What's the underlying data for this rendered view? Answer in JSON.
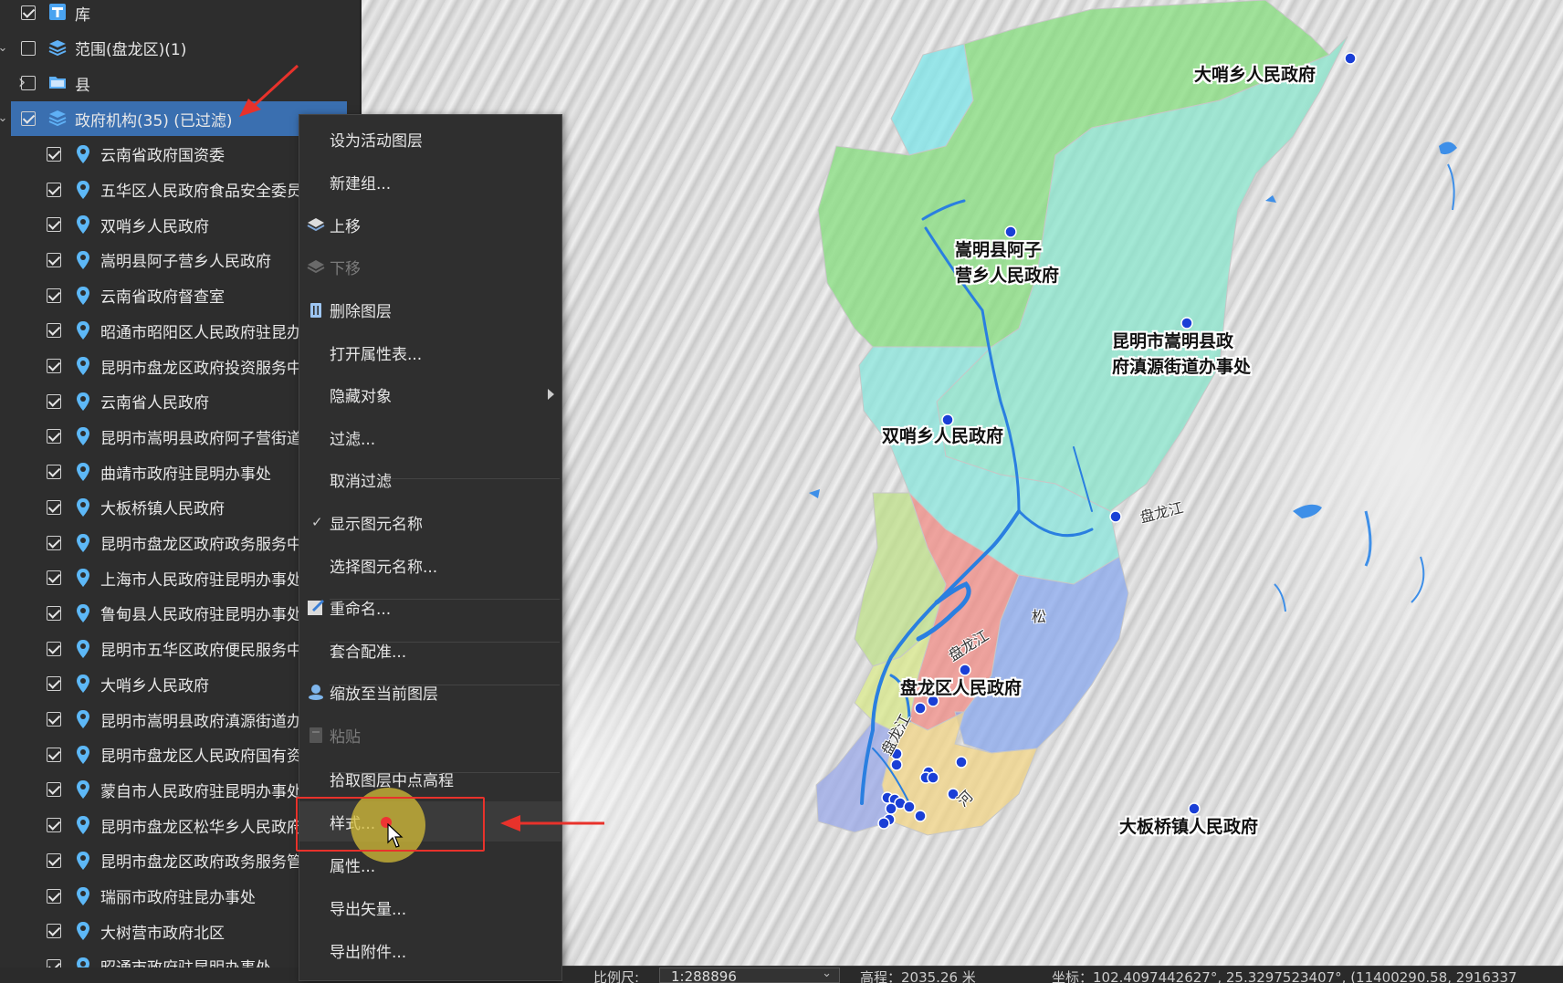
{
  "tree": {
    "rows": [
      {
        "label": "库",
        "icon": "table-icon",
        "checked": true,
        "expander": ""
      },
      {
        "label": "范围(盘龙区)(1)",
        "icon": "layers-icon",
        "checked": false,
        "expander": "down"
      },
      {
        "label": "县",
        "icon": "folder-icon",
        "checked": false,
        "expander": "right"
      },
      {
        "label": "政府机构(35) (已过滤)",
        "icon": "layers-icon",
        "checked": true,
        "expander": "down",
        "selected": true
      },
      {
        "label": "云南省政府国资委",
        "icon": "pin-icon",
        "checked": true
      },
      {
        "label": "五华区人民政府食品安全委员",
        "icon": "pin-icon",
        "checked": true
      },
      {
        "label": "双哨乡人民政府",
        "icon": "pin-icon",
        "checked": true
      },
      {
        "label": "嵩明县阿子营乡人民政府",
        "icon": "pin-icon",
        "checked": true
      },
      {
        "label": "云南省政府督查室",
        "icon": "pin-icon",
        "checked": true
      },
      {
        "label": "昭通市昭阳区人民政府驻昆办",
        "icon": "pin-icon",
        "checked": true
      },
      {
        "label": "昆明市盘龙区政府投资服务中",
        "icon": "pin-icon",
        "checked": true
      },
      {
        "label": "云南省人民政府",
        "icon": "pin-icon",
        "checked": true
      },
      {
        "label": "昆明市嵩明县政府阿子营街道",
        "icon": "pin-icon",
        "checked": true
      },
      {
        "label": "曲靖市政府驻昆明办事处",
        "icon": "pin-icon",
        "checked": true
      },
      {
        "label": "大板桥镇人民政府",
        "icon": "pin-icon",
        "checked": true
      },
      {
        "label": "昆明市盘龙区政府政务服务中",
        "icon": "pin-icon",
        "checked": true
      },
      {
        "label": "上海市人民政府驻昆明办事处",
        "icon": "pin-icon",
        "checked": true
      },
      {
        "label": "鲁甸县人民政府驻昆明办事处",
        "icon": "pin-icon",
        "checked": true
      },
      {
        "label": "昆明市五华区政府便民服务中",
        "icon": "pin-icon",
        "checked": true
      },
      {
        "label": "大哨乡人民政府",
        "icon": "pin-icon",
        "checked": true
      },
      {
        "label": "昆明市嵩明县政府滇源街道办",
        "icon": "pin-icon",
        "checked": true
      },
      {
        "label": "昆明市盘龙区人民政府国有资",
        "icon": "pin-icon",
        "checked": true
      },
      {
        "label": "蒙自市人民政府驻昆明办事处",
        "icon": "pin-icon",
        "checked": true
      },
      {
        "label": "昆明市盘龙区松华乡人民政府",
        "icon": "pin-icon",
        "checked": true
      },
      {
        "label": "昆明市盘龙区政府政务服务管",
        "icon": "pin-icon",
        "checked": true
      },
      {
        "label": "瑞丽市政府驻昆办事处",
        "icon": "pin-icon",
        "checked": true
      },
      {
        "label": "大树营市政府北区",
        "icon": "pin-icon",
        "checked": true
      },
      {
        "label": "昭通市政府驻昆明办事处",
        "icon": "pin-icon",
        "checked": true
      }
    ]
  },
  "menu": {
    "items": [
      {
        "label": "设为活动图层",
        "icon": "",
        "state": "normal"
      },
      {
        "label": "新建组...",
        "icon": "",
        "state": "normal"
      },
      {
        "label": "上移",
        "icon": "move-up-icon",
        "state": "normal"
      },
      {
        "label": "下移",
        "icon": "move-down-icon",
        "state": "disabled"
      },
      {
        "label": "删除图层",
        "icon": "trash-icon",
        "state": "normal"
      },
      {
        "label": "打开属性表...",
        "icon": "",
        "state": "normal"
      },
      {
        "label": "隐藏对象",
        "icon": "",
        "state": "normal",
        "submenu": true
      },
      {
        "label": "过滤...",
        "icon": "",
        "state": "normal"
      },
      {
        "label": "取消过滤",
        "icon": "",
        "state": "normal"
      },
      {
        "label": "显示图元名称",
        "icon": "check-icon",
        "state": "checked"
      },
      {
        "label": "选择图元名称...",
        "icon": "",
        "state": "normal"
      },
      {
        "label": "重命名...",
        "icon": "rename-icon",
        "state": "normal"
      },
      {
        "label": "套合配准...",
        "icon": "",
        "state": "normal"
      },
      {
        "label": "缩放至当前图层",
        "icon": "zoom-pin-icon",
        "state": "normal"
      },
      {
        "label": "粘贴",
        "icon": "paste-icon",
        "state": "disabled"
      },
      {
        "label": "拾取图层中点高程",
        "icon": "",
        "state": "normal"
      },
      {
        "label": "样式...",
        "icon": "",
        "state": "hover"
      },
      {
        "label": "属性...",
        "icon": "",
        "state": "normal"
      },
      {
        "label": "导出矢量...",
        "icon": "",
        "state": "normal"
      },
      {
        "label": "导出附件...",
        "icon": "",
        "state": "normal"
      }
    ]
  },
  "map": {
    "place_labels": [
      {
        "text": "大哨乡人民政府"
      },
      {
        "text": "嵩明县阿子\n营乡人民政府"
      },
      {
        "text": "昆明市嵩明县政\n府滇源街道办事处"
      },
      {
        "text": "双哨乡人民政府"
      },
      {
        "text": "盘龙区人民政府"
      },
      {
        "text": "大板桥镇人民政府"
      }
    ],
    "river_labels": [
      "盘龙江",
      "盘龙江",
      "盘龙江",
      "松",
      "河"
    ]
  },
  "status": {
    "scale_label": "比例尺:",
    "scale_value": "1:288896",
    "elevation": "高程：2035.26 米",
    "coords": "坐标：102.4097442627°, 25.3297523407°, (11400290.58, 2916337"
  },
  "colors": {
    "panel_bg": "#2d2d2d",
    "selection": "#3a6fb0",
    "annotation_red": "#e8322b",
    "point_blue": "#1a3fd6",
    "river_blue": "#2a7fe0"
  }
}
